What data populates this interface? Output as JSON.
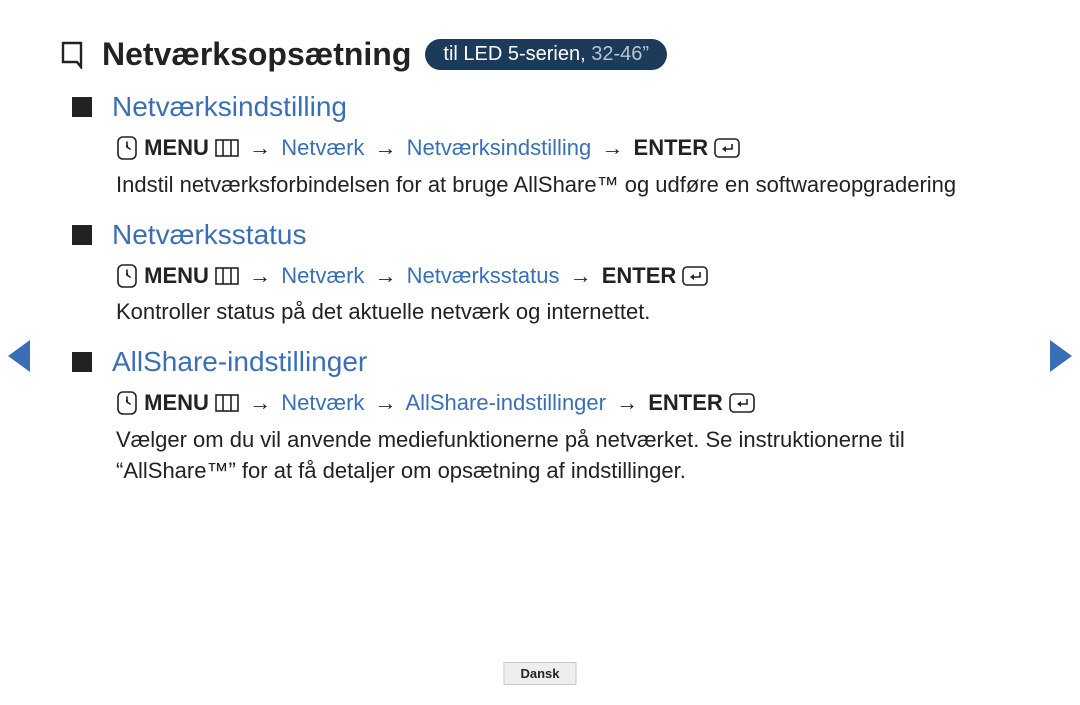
{
  "header": {
    "title": "Netværksopsætning",
    "pill_main": "til LED 5-serien, ",
    "pill_dim": "32-46”"
  },
  "sections": [
    {
      "title": "Netværksindstilling",
      "menu_label": "MENU",
      "path_a": "Netværk",
      "path_b": "Netværksindstilling",
      "enter_label": "ENTER",
      "desc": "Indstil netværksforbindelsen for at bruge AllShare™ og udføre en softwareopgradering"
    },
    {
      "title": "Netværksstatus",
      "menu_label": "MENU",
      "path_a": "Netværk",
      "path_b": "Netværksstatus",
      "enter_label": "ENTER",
      "desc": "Kontroller status på det aktuelle netværk og internettet."
    },
    {
      "title": "AllShare-indstillinger",
      "menu_label": "MENU",
      "path_a": "Netværk",
      "path_b": "AllShare-indstillinger",
      "enter_label": "ENTER",
      "desc": "Vælger om du vil anvende mediefunktionerne på netværket. Se instruktionerne til “AllShare™” for at få detaljer om opsætning af indstillinger."
    }
  ],
  "icons": {
    "arrow_sep": "→"
  },
  "footer": {
    "language": "Dansk"
  }
}
